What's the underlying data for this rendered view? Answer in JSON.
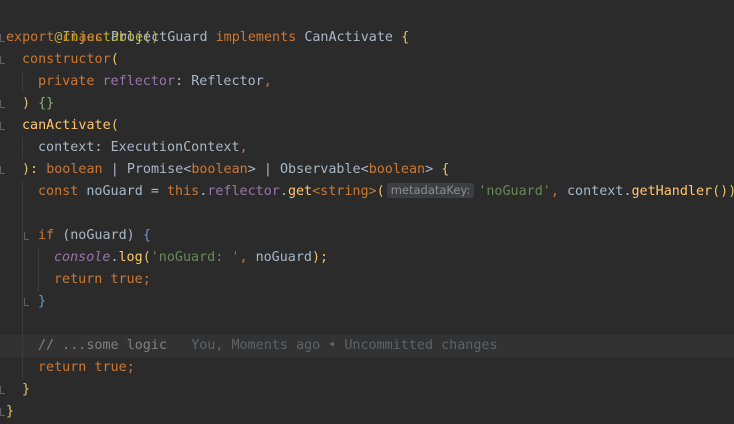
{
  "editor": {
    "lines": {
      "l1": {
        "decorator": "@Injectable()"
      },
      "l2": {
        "export": "export",
        "class_kw": "class",
        "name": "ProjectGuard",
        "implements": "implements",
        "iface": "CanActivate",
        "brace": "{"
      },
      "l3": {
        "ctor": "constructor",
        "paren": "("
      },
      "l4": {
        "private": "private",
        "prop": "reflector",
        "colon": ":",
        "type": "Reflector",
        "comma": ","
      },
      "l5": {
        "close": ")",
        "body": "{}"
      },
      "l6": {
        "method": "canActivate",
        "paren": "("
      },
      "l7": {
        "param": "context",
        "colon": ":",
        "type": "ExecutionContext",
        "comma": ","
      },
      "l8": {
        "close": "):",
        "boolean": "boolean",
        "pipe1": "|",
        "promise": "Promise",
        "lt1": "<",
        "boolean2": "boolean",
        "gt1": ">",
        "pipe2": "|",
        "observable": "Observable",
        "lt2": "<",
        "boolean3": "boolean",
        "gt2": ">",
        "brace": "{"
      },
      "l9": {
        "const": "const",
        "var": "noGuard",
        "eq": "=",
        "this": "this",
        "dot1": ".",
        "reflector": "reflector",
        "dot2": ".",
        "get": "get",
        "generic": "<string>",
        "paren": "(",
        "hint": "metadataKey:",
        "str": "'noGuard'",
        "comma": ",",
        "ctx": "context",
        "dot3": ".",
        "handler": "getHandler",
        "tail": "());"
      },
      "l11": {
        "if": "if",
        "cond": "(noGuard)",
        "brace": "{"
      },
      "l12": {
        "console": "console",
        "dot": ".",
        "log": "log",
        "open": "(",
        "str": "'noGuard: '",
        "comma": ",",
        "arg": "noGuard",
        "close": ");"
      },
      "l13": {
        "return": "return",
        "value": "true",
        "semi": ";"
      },
      "l14": {
        "brace": "}"
      },
      "l16": {
        "comment": "// ...some logic",
        "blame": "You, Moments ago • Uncommitted changes"
      },
      "l17": {
        "return": "return",
        "value": "true",
        "semi": ";"
      },
      "l18": {
        "brace": "}"
      },
      "l19": {
        "brace": "}"
      }
    }
  }
}
